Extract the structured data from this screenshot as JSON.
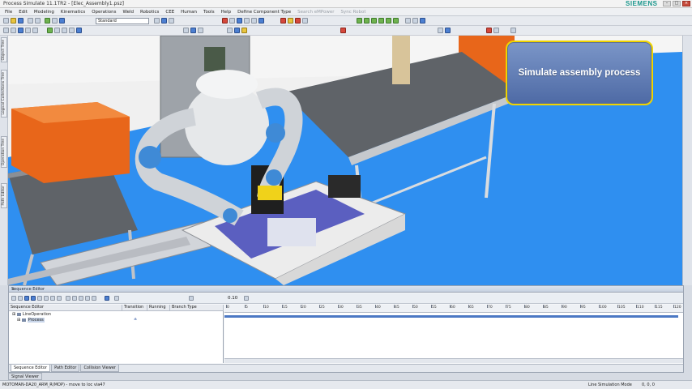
{
  "window": {
    "title": "Process Simulate 11.1TR2 - [Elec_Assembly1.psz]",
    "brand": "SIEMENS"
  },
  "menu": [
    "File",
    "Edit",
    "Modeling",
    "Kinematics",
    "Operations",
    "Weld",
    "Robotics",
    "CEE",
    "Human",
    "Tools",
    "Help",
    "Define Component Type",
    "Search eMPower",
    "Sync Robot"
  ],
  "toolbar": {
    "layout_combo": "Standard"
  },
  "left_tabs": [
    "Object Tree",
    "Logical Collections Tree",
    "Operation Tree",
    "Path Editor"
  ],
  "callout": {
    "text": "Simulate assembly process"
  },
  "sequence_editor": {
    "title": "Sequence Editor",
    "time_value": "0.10",
    "columns": [
      "Sequence Editor",
      "Transition",
      "Running",
      "Branch Type"
    ],
    "rows": [
      {
        "label": "LineOperation",
        "level": 0
      },
      {
        "label": "Process",
        "level": 1
      }
    ],
    "ruler_ticks": [
      "0",
      "5",
      "10",
      "15",
      "20",
      "25",
      "30",
      "35",
      "40",
      "45",
      "50",
      "55",
      "60",
      "65",
      "70",
      "75",
      "80",
      "85",
      "90",
      "95",
      "100",
      "105",
      "110",
      "115",
      "120"
    ],
    "tabs": [
      "Sequence Editor",
      "Path Editor",
      "Collision Viewer"
    ],
    "sub_tab": "Signal Viewer"
  },
  "status": {
    "message": "MOTOMAN-DA20_ARM_R(MOP) - move to loc via47",
    "mode": "Line Simulation Mode",
    "coords": "0, 0, 0"
  },
  "colors": {
    "floor": "#2f8ff0",
    "callout_border": "#f0d400",
    "callout_fill": "#5f7ab3",
    "cabinet": "#e8661a"
  }
}
